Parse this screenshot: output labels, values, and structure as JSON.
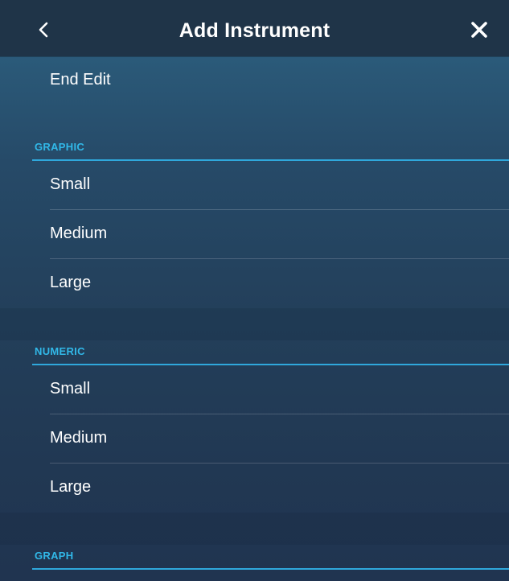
{
  "header": {
    "title": "Add Instrument",
    "back_icon": "chevron-left-icon",
    "close_icon": "close-icon"
  },
  "actions": {
    "end_edit": "End Edit"
  },
  "sections": {
    "graphic": {
      "label": "GRAPHIC",
      "items": [
        "Small",
        "Medium",
        "Large"
      ]
    },
    "numeric": {
      "label": "NUMERIC",
      "items": [
        "Small",
        "Medium",
        "Large"
      ]
    },
    "graph": {
      "label": "GRAPH"
    }
  },
  "colors": {
    "accent": "#31b8e8",
    "header_bg": "#1f3448",
    "text": "#ffffff"
  }
}
